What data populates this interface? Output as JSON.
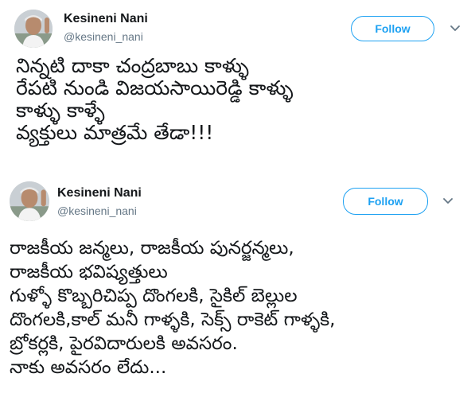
{
  "tweets": [
    {
      "author_name": "Kesineni Nani",
      "handle": "@kesineni_nani",
      "follow_label": "Follow",
      "text": "నిన్నటి దాకా చంద్రబాబు కాళ్ళు\nరేపటి నుండి విజయసాయిరెడ్డి కాళ్ళు\nకాళ్ళు కాళ్ళే\nవ్యక్తులు మాత్రమే తేడా!!!"
    },
    {
      "author_name": "Kesineni Nani",
      "handle": "@kesineni_nani",
      "follow_label": "Follow",
      "text": "రాజకీయ జన్మలు, రాజకీయ పునర్జన్మలు,\nరాజకీయ భవిష్యత్తులు\nగుళ్ళో కొబ్బరిచిప్ప దొంగలకి, సైకిల్ బెల్లుల\nదొంగలకి,కాల్ మనీ గాళ్ళకి, సెక్స్ రాకెట్ గాళ్ళకి,\nబ్రోకర్లకి, పైరవిదారులకి అవసరం.\nనాకు అవసరం లేదు..."
    }
  ],
  "icons": {
    "avatar": "profile-photo",
    "caret": "chevron-down-icon"
  },
  "colors": {
    "accent": "#1da1f2",
    "name": "#14171a",
    "handle": "#657786"
  }
}
